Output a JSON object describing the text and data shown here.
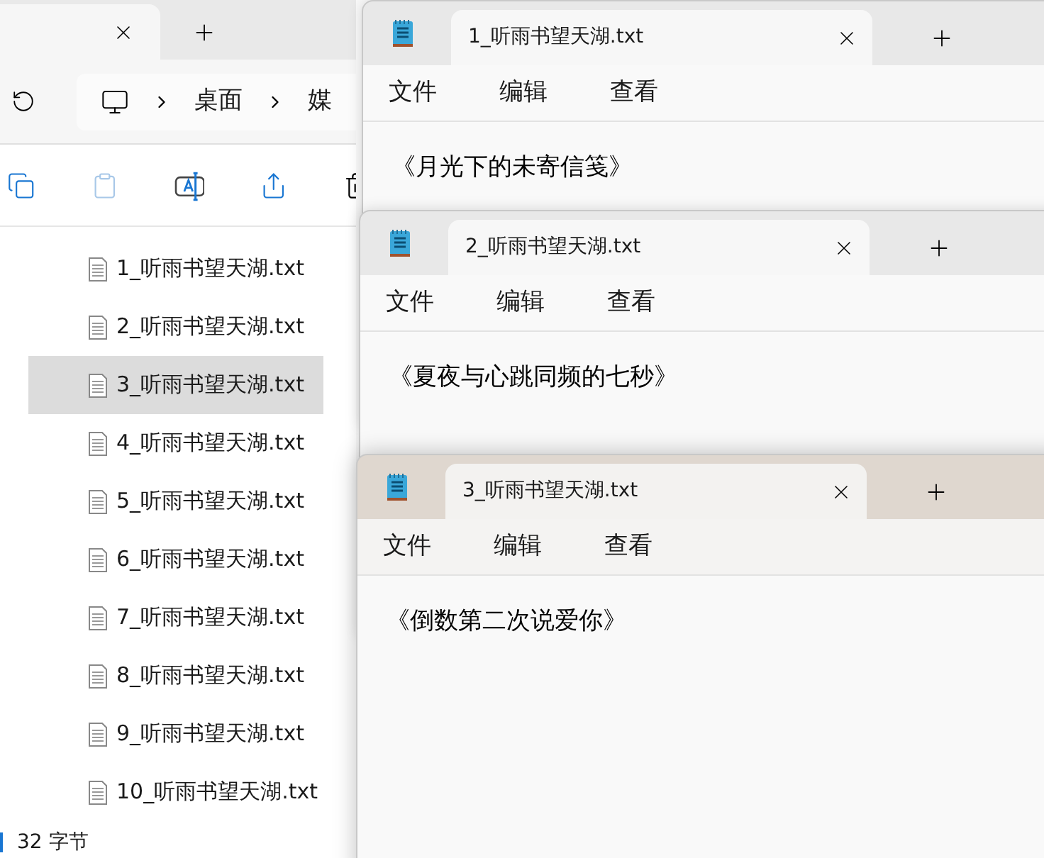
{
  "explorer": {
    "address": [
      "桌面",
      "媒"
    ],
    "files": [
      {
        "name": "1_听雨书望天湖.txt",
        "selected": false
      },
      {
        "name": "2_听雨书望天湖.txt",
        "selected": false
      },
      {
        "name": "3_听雨书望天湖.txt",
        "selected": true
      },
      {
        "name": "4_听雨书望天湖.txt",
        "selected": false
      },
      {
        "name": "5_听雨书望天湖.txt",
        "selected": false
      },
      {
        "name": "6_听雨书望天湖.txt",
        "selected": false
      },
      {
        "name": "7_听雨书望天湖.txt",
        "selected": false
      },
      {
        "name": "8_听雨书望天湖.txt",
        "selected": false
      },
      {
        "name": "9_听雨书望天湖.txt",
        "selected": false
      },
      {
        "name": "10_听雨书望天湖.txt",
        "selected": false
      }
    ],
    "status": "32 字节"
  },
  "notepads": [
    {
      "tab_title": "1_听雨书望天湖.txt",
      "menu": [
        "文件",
        "编辑",
        "查看"
      ],
      "content": "《月光下的未寄信笺》",
      "active": false
    },
    {
      "tab_title": "2_听雨书望天湖.txt",
      "menu": [
        "文件",
        "编辑",
        "查看"
      ],
      "content": "《夏夜与心跳同频的七秒》",
      "active": false
    },
    {
      "tab_title": "3_听雨书望天湖.txt",
      "menu": [
        "文件",
        "编辑",
        "查看"
      ],
      "content": "《倒数第二次说爱你》",
      "active": true
    }
  ]
}
